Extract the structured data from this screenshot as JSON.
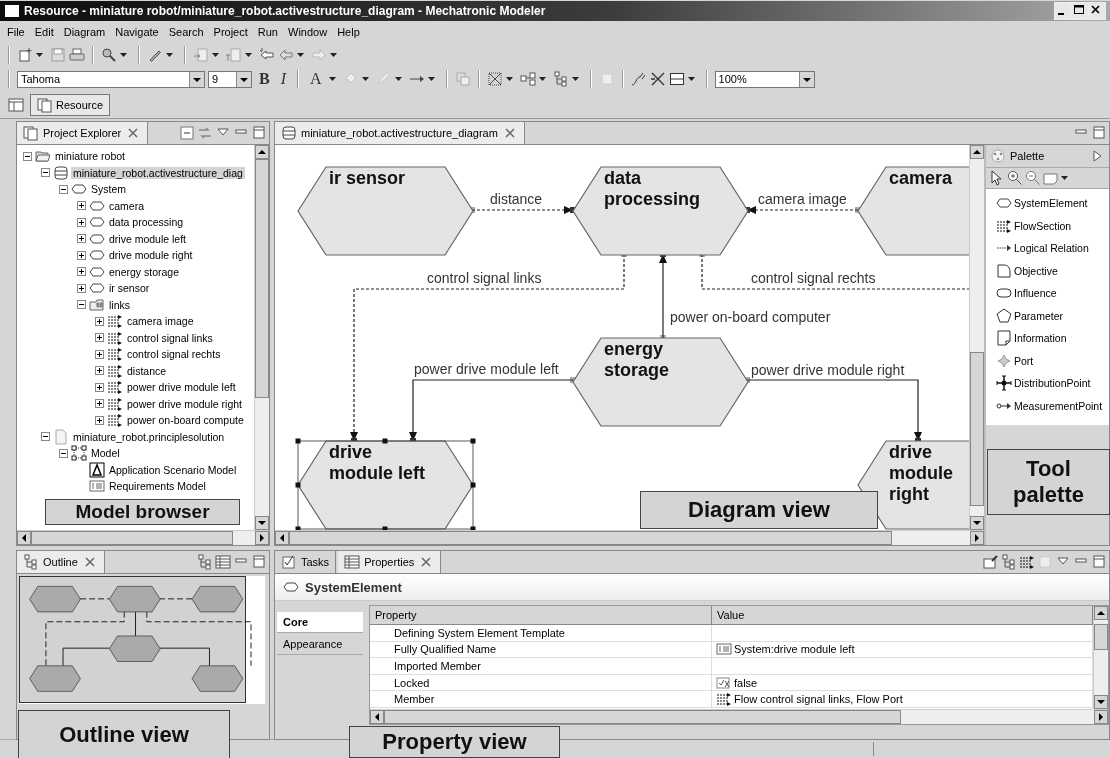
{
  "window": {
    "title": "Resource - miniature robot/miniature_robot.activestructure_diagram - Mechatronic Modeler"
  },
  "menu": [
    "File",
    "Edit",
    "Diagram",
    "Navigate",
    "Search",
    "Project",
    "Run",
    "Window",
    "Help"
  ],
  "format_toolbar": {
    "font": "Tahoma",
    "size": "9",
    "bold": "B",
    "italic": "I",
    "font_color": "A",
    "zoom": "100%"
  },
  "perspectives": [
    {
      "label": "Resource",
      "selected": true
    }
  ],
  "project_explorer": {
    "title": "Project Explorer",
    "tree": [
      {
        "label": "miniature robot",
        "kind": "project",
        "expanded": true,
        "selected": false,
        "children": [
          {
            "label": "miniature_robot.activestructure_diag",
            "kind": "diagram",
            "expanded": true,
            "selected": true,
            "children": [
              {
                "label": "System",
                "kind": "element",
                "expanded": true,
                "selected": false,
                "children": [
                  {
                    "label": "camera",
                    "kind": "element",
                    "expanded": false,
                    "selected": false
                  },
                  {
                    "label": "data processing",
                    "kind": "element",
                    "expanded": false,
                    "selected": false
                  },
                  {
                    "label": "drive module left",
                    "kind": "element",
                    "expanded": false,
                    "selected": false
                  },
                  {
                    "label": "drive module right",
                    "kind": "element",
                    "expanded": false,
                    "selected": false
                  },
                  {
                    "label": "energy storage",
                    "kind": "element",
                    "expanded": false,
                    "selected": false
                  },
                  {
                    "label": "ir sensor",
                    "kind": "element",
                    "expanded": false,
                    "selected": false
                  },
                  {
                    "label": "links",
                    "kind": "links",
                    "expanded": true,
                    "selected": false,
                    "children": [
                      {
                        "label": "camera image",
                        "kind": "flow",
                        "expanded": false,
                        "selected": false
                      },
                      {
                        "label": "control signal links",
                        "kind": "flow",
                        "expanded": false,
                        "selected": false
                      },
                      {
                        "label": "control signal rechts",
                        "kind": "flow",
                        "expanded": false,
                        "selected": false
                      },
                      {
                        "label": "distance",
                        "kind": "flow",
                        "expanded": false,
                        "selected": false
                      },
                      {
                        "label": "power drive module left",
                        "kind": "flow",
                        "expanded": false,
                        "selected": false
                      },
                      {
                        "label": "power drive module right",
                        "kind": "flow",
                        "expanded": false,
                        "selected": false
                      },
                      {
                        "label": "power on-board compute",
                        "kind": "flow",
                        "expanded": false,
                        "selected": false
                      }
                    ]
                  }
                ]
              }
            ]
          },
          {
            "label": "miniature_robot.principlesolution",
            "kind": "file",
            "expanded": true,
            "selected": false,
            "children": [
              {
                "label": "Model",
                "kind": "model",
                "expanded": true,
                "selected": false,
                "children": [
                  {
                    "label": "Application Scenario Model",
                    "kind": "scenario",
                    "selected": false
                  },
                  {
                    "label": "Requirements Model",
                    "kind": "requirements",
                    "selected": false
                  }
                ]
              }
            ]
          }
        ]
      }
    ]
  },
  "outline": {
    "title": "Outline"
  },
  "editor": {
    "tab": "miniature_robot.activestructure_diagram",
    "nodes": [
      {
        "label": "ir sensor",
        "selected": false
      },
      {
        "label": "data processing",
        "selected": false
      },
      {
        "label": "camera",
        "selected": false
      },
      {
        "label": "energy storage",
        "selected": false
      },
      {
        "label": "drive module left",
        "selected": true
      },
      {
        "label": "drive module right",
        "selected": false
      }
    ],
    "links": [
      {
        "label": "distance",
        "kind": "logical"
      },
      {
        "label": "camera image",
        "kind": "logical"
      },
      {
        "label": "control signal links",
        "kind": "logical"
      },
      {
        "label": "control signal rechts",
        "kind": "logical"
      },
      {
        "label": "power on-board computer",
        "kind": "energy"
      },
      {
        "label": "power drive module left",
        "kind": "energy"
      },
      {
        "label": "power drive module right",
        "kind": "energy"
      }
    ]
  },
  "palette": {
    "title": "Palette",
    "tools": [
      {
        "label": "SystemElement",
        "kind": "system-element"
      },
      {
        "label": "FlowSection",
        "kind": "flow-section"
      },
      {
        "label": "Logical Relation",
        "kind": "logical-relation"
      },
      {
        "label": "Objective",
        "kind": "objective"
      },
      {
        "label": "Influence",
        "kind": "influence"
      },
      {
        "label": "Parameter",
        "kind": "parameter"
      },
      {
        "label": "Information",
        "kind": "information"
      },
      {
        "label": "Port",
        "kind": "port"
      },
      {
        "label": "DistributionPoint",
        "kind": "distribution-point"
      },
      {
        "label": "MeasurementPoint",
        "kind": "measurement-point"
      }
    ]
  },
  "properties": {
    "tabs": [
      {
        "label": "Tasks",
        "selected": false
      },
      {
        "label": "Properties",
        "selected": true
      }
    ],
    "heading": "SystemElement",
    "sections": [
      {
        "label": "Core",
        "selected": true
      },
      {
        "label": "Appearance",
        "selected": false
      }
    ],
    "columns": [
      "Property",
      "Value"
    ],
    "rows": [
      {
        "property": "Defining System Element Template"
      },
      {
        "property": "Fully Qualified Name",
        "value": "System:drive module left",
        "kind": "name"
      },
      {
        "property": "Imported Member"
      },
      {
        "property": "Locked",
        "value": "false",
        "kind": "boolean"
      },
      {
        "property": "Member",
        "value": "Flow control signal links, Flow Port",
        "kind": "flow"
      }
    ]
  },
  "annotations": [
    "Model browser",
    "Diagram view",
    "Tool palette",
    "Outline view",
    "Property view"
  ]
}
